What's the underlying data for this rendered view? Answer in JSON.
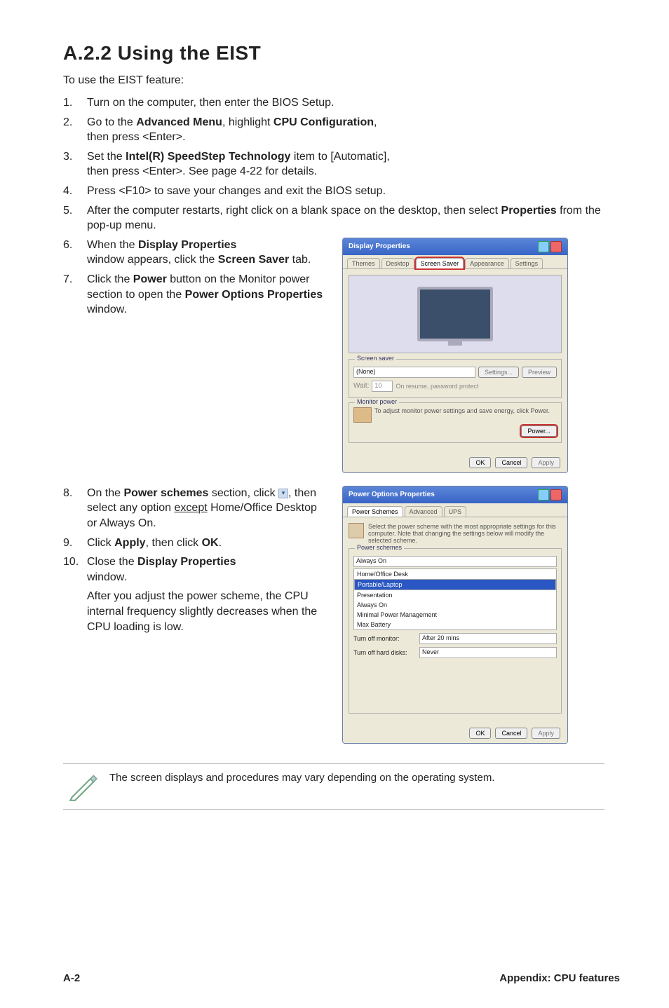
{
  "heading": "A.2.2   Using the EIST",
  "intro": "To use the EIST feature:",
  "steps": [
    {
      "pre": "Turn on the computer, then enter the BIOS Setup."
    },
    {
      "pre": "Go to the ",
      "b1": "Advanced Menu",
      "mid1": ", highlight ",
      "b2": "CPU Configuration",
      "mid2": ",",
      "line2": "then press <Enter>."
    },
    {
      "pre": "Set the ",
      "b1": "Intel(R) SpeedStep Technology",
      "mid1": " item to [Automatic],",
      "line2": "then press <Enter>. See page 4-22 for details."
    },
    {
      "pre": "Press <F10> to save your changes and exit the BIOS setup."
    },
    {
      "pre": "After the computer restarts, right click on a blank space on the desktop, then select ",
      "b1": "Properties",
      "mid1": " from the pop-up menu."
    },
    {
      "pre": "When the ",
      "b1": "Display Properties",
      "line2a": "window appears, click the ",
      "b2": "Screen Saver",
      "line2b": " tab."
    },
    {
      "pre": "Click the ",
      "b1": "Power",
      "mid1": " button on the Monitor power section to open the ",
      "b2": "Power Options Properties",
      "line2": "window."
    },
    {
      "pre": "On the ",
      "b1": "Power schemes",
      "mid1": " section, click ",
      "dd": true,
      "mid2": ", then select any option ",
      "u": "except",
      "mid3": " Home/Office Desktop or Always On."
    },
    {
      "pre": "Click ",
      "b1": "Apply",
      "mid1": ", then click ",
      "b2": "OK",
      "mid2": "."
    },
    {
      "pre": "Close the ",
      "b1": "Display Properties",
      "line2": "window."
    }
  ],
  "after_para": "After you adjust the power scheme, the CPU internal frequency slightly decreases when the CPU loading is low.",
  "note": "The screen displays and procedures may vary depending on the operating system.",
  "footer_page": "A-2",
  "footer_section": "Appendix: CPU features",
  "win1": {
    "title": "Display Properties",
    "tabs": [
      "Themes",
      "Desktop",
      "Screen Saver",
      "Appearance",
      "Settings"
    ],
    "active_tab": 2,
    "group_ss": "Screen saver",
    "ss_value": "(None)",
    "btn_settings": "Settings...",
    "btn_preview": "Preview",
    "wait_label": "Wait:",
    "wait_value": "10",
    "resume_label": "On resume, password protect",
    "group_mon": "Monitor power",
    "mon_text": "To adjust monitor power settings and save energy, click Power.",
    "btn_power": "Power...",
    "btn_ok": "OK",
    "btn_cancel": "Cancel",
    "btn_apply": "Apply"
  },
  "win2": {
    "title": "Power Options Properties",
    "tabs": [
      "Power Schemes",
      "Advanced",
      "UPS"
    ],
    "active_tab": 0,
    "desc": "Select the power scheme with the most appropriate settings for this computer. Note that changing the settings below will modify the selected scheme.",
    "group_ps": "Power schemes",
    "ps_value": "Always On",
    "options": [
      "Home/Office Desk",
      "Portable/Laptop",
      "Presentation",
      "Always On",
      "Minimal Power Management",
      "Max Battery"
    ],
    "selected_idx": 1,
    "mon_label": "Turn off monitor:",
    "mon_val": "After 20 mins",
    "hd_label": "Turn off hard disks:",
    "hd_val": "Never",
    "btn_ok": "OK",
    "btn_cancel": "Cancel",
    "btn_apply": "Apply"
  }
}
